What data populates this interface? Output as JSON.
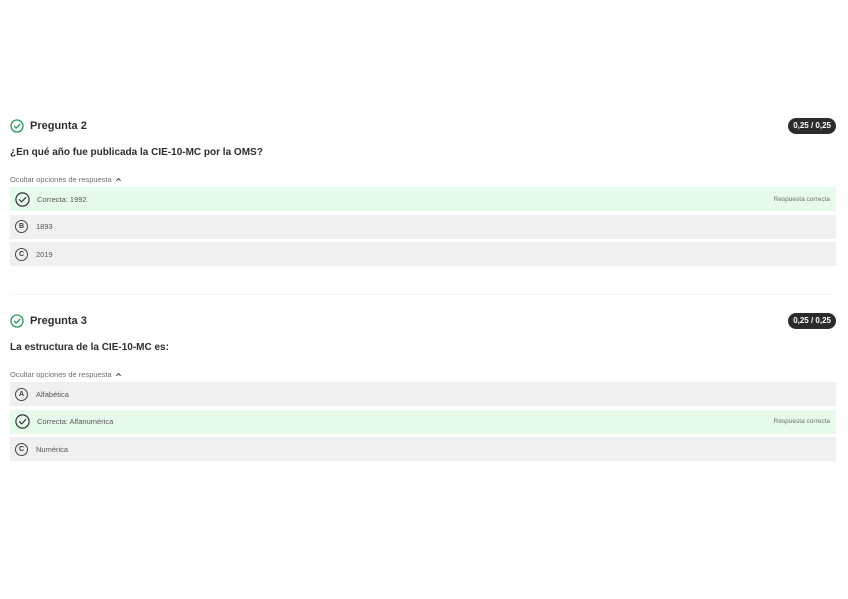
{
  "questions": [
    {
      "title": "Pregunta 2",
      "score": "0,25 / 0,25",
      "prompt": "¿En qué año fue publicada la CIE-10-MC por la OMS?",
      "toggle_label": "Ocultar opciones de respuesta",
      "options": [
        {
          "type": "correct",
          "text": "Correcta: 1992",
          "note": "Respuesta correcta"
        },
        {
          "type": "letter",
          "letter": "B",
          "text": "1893"
        },
        {
          "type": "letter",
          "letter": "C",
          "text": "2019"
        }
      ]
    },
    {
      "title": "Pregunta 3",
      "score": "0,25 / 0,25",
      "prompt": "La estructura de la CIE-10-MC es:",
      "toggle_label": "Ocultar opciones de respuesta",
      "options": [
        {
          "type": "letter",
          "letter": "A",
          "text": "Alfabética"
        },
        {
          "type": "correct",
          "text": "Correcta: Alfanumérica",
          "note": "Respuesta correcta"
        },
        {
          "type": "letter",
          "letter": "C",
          "text": "Numérica"
        }
      ]
    }
  ],
  "colors": {
    "success": "#1f9a5a",
    "correct_bg": "#e7fbed",
    "option_bg": "#f0f0f0",
    "badge_bg": "#2b2b2b"
  }
}
